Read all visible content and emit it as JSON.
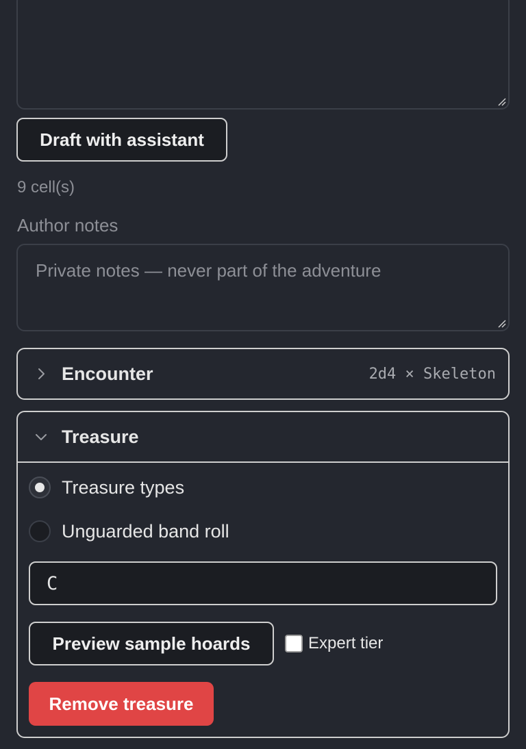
{
  "description_area": {
    "value": ""
  },
  "draft_button": {
    "label": "Draft with assistant"
  },
  "cells_count": "9 cell(s)",
  "author_notes": {
    "label": "Author notes",
    "placeholder": "Private notes — never part of the adventure"
  },
  "encounter": {
    "title": "Encounter",
    "summary": "2d4 × Skeleton",
    "expanded": false
  },
  "treasure": {
    "title": "Treasure",
    "expanded": true,
    "options": [
      {
        "label": "Treasure types",
        "selected": true
      },
      {
        "label": "Unguarded band roll",
        "selected": false
      }
    ],
    "type_input_value": "C",
    "preview_button": "Preview sample hoards",
    "expert_tier": {
      "label": "Expert tier",
      "checked": false
    },
    "remove_button": "Remove treasure"
  },
  "colors": {
    "background": "#24272f",
    "danger": "#e04545",
    "border_light": "#cfcfcf",
    "muted_text": "#8d8f96"
  },
  "icons": {
    "collapsed": "chevron-right-icon",
    "expanded": "chevron-down-icon"
  }
}
